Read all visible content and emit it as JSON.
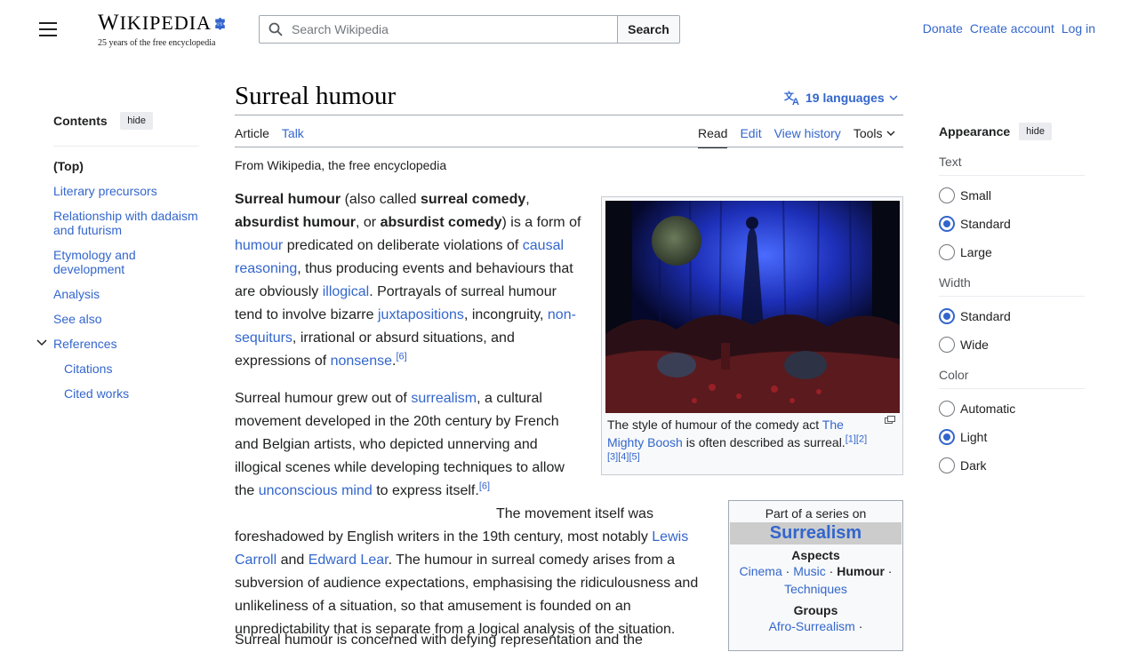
{
  "header": {
    "logo_word_first": "W",
    "logo_word_rest": "IKIPEDIA",
    "logo_tagline": "25 years of the free encyclopedia",
    "search_placeholder": "Search Wikipedia",
    "search_button": "Search",
    "user_links": [
      "Donate",
      "Create account",
      "Log in"
    ]
  },
  "toc": {
    "heading": "Contents",
    "hide_label": "hide",
    "items": [
      {
        "label": "(Top)"
      },
      {
        "label": "Literary precursors"
      },
      {
        "label": "Relationship with dadaism and futurism"
      },
      {
        "label": "Etymology and development"
      },
      {
        "label": "Analysis"
      },
      {
        "label": "See also"
      },
      {
        "label": "References"
      },
      {
        "label": "Citations"
      },
      {
        "label": "Cited works"
      }
    ]
  },
  "article": {
    "title": "Surreal humour",
    "languages": "19 languages",
    "tabs_left": [
      "Article",
      "Talk"
    ],
    "tabs_right": [
      "Read",
      "Edit",
      "View history",
      "Tools"
    ],
    "tagline": "From Wikipedia, the free encyclopedia",
    "p1": {
      "b1": "Surreal humour",
      "t1": " (also called ",
      "b2": "surreal comedy",
      "t2": ", ",
      "b3": "absurdist humour",
      "t3": ", or ",
      "b4": "absurdist comedy",
      "t4": ") is a form of ",
      "l1": "humour",
      "t5": " predicated on deliberate violations of ",
      "l2": "causal reasoning",
      "t6": ", thus producing events and behaviours that are obviously ",
      "l3": "illogical",
      "t7": ". Portrayals of surreal humour tend to involve bizarre ",
      "l4": "juxtapositions",
      "t8": ", incongruity, ",
      "l5": "non-sequiturs",
      "t9": ", irrational or absurd situations, and expressions of ",
      "l6": "nonsense",
      "t10": ".",
      "ref": "[6]"
    },
    "p2": {
      "t1": "Surreal humour grew out of ",
      "l1": "surrealism",
      "t2": ", a cultural movement developed in the 20th century by French and Belgian artists, who depicted unnerving and illogical scenes while developing techniques to allow the ",
      "l2": "unconscious mind",
      "t3": " to express itself.",
      "ref": "[6]",
      "t4": " The movement itself was foreshadowed by English writers in the 19th century, most notably ",
      "l3": "Lewis Carroll",
      "t5": " and ",
      "l4": "Edward Lear",
      "t6": ". The humour in surreal comedy arises from a subversion of audience expectations, emphasising the ridiculousness and unlikeliness of a situation, so that amusement is founded on an unpredictability that is separate from a logical analysis of the situation."
    },
    "p3_partial": "Surreal humour is concerned with defying representation and the",
    "figure": {
      "cap_t1": "The style of humour of the comedy act ",
      "cap_l1": "The Mighty Boosh",
      "cap_t2": " is often described as surreal.",
      "cap_refs": "[1][2][3][4][5]"
    },
    "infobox": {
      "part_of": "Part of a series on",
      "title": "Surrealism",
      "aspects_heading": "Aspects",
      "aspects": [
        "Cinema",
        "Music",
        "Humour",
        "Techniques"
      ],
      "groups_heading": "Groups",
      "groups": [
        "Afro-Surrealism"
      ]
    }
  },
  "appearance": {
    "heading": "Appearance",
    "hide_label": "hide",
    "text_label": "Text",
    "text_options": [
      "Small",
      "Standard",
      "Large"
    ],
    "text_selected": "Standard",
    "width_label": "Width",
    "width_options": [
      "Standard",
      "Wide"
    ],
    "width_selected": "Standard",
    "color_label": "Color",
    "color_options": [
      "Automatic",
      "Light",
      "Dark"
    ],
    "color_selected": "Light"
  },
  "colors": {
    "link": "#3366cc",
    "text": "#202122",
    "border": "#a2a9b1"
  },
  "icons": [
    "menu-icon",
    "search-icon",
    "translate-icon",
    "chevron-down-icon",
    "magnify-icon",
    "puzzle-globe-icon"
  ]
}
